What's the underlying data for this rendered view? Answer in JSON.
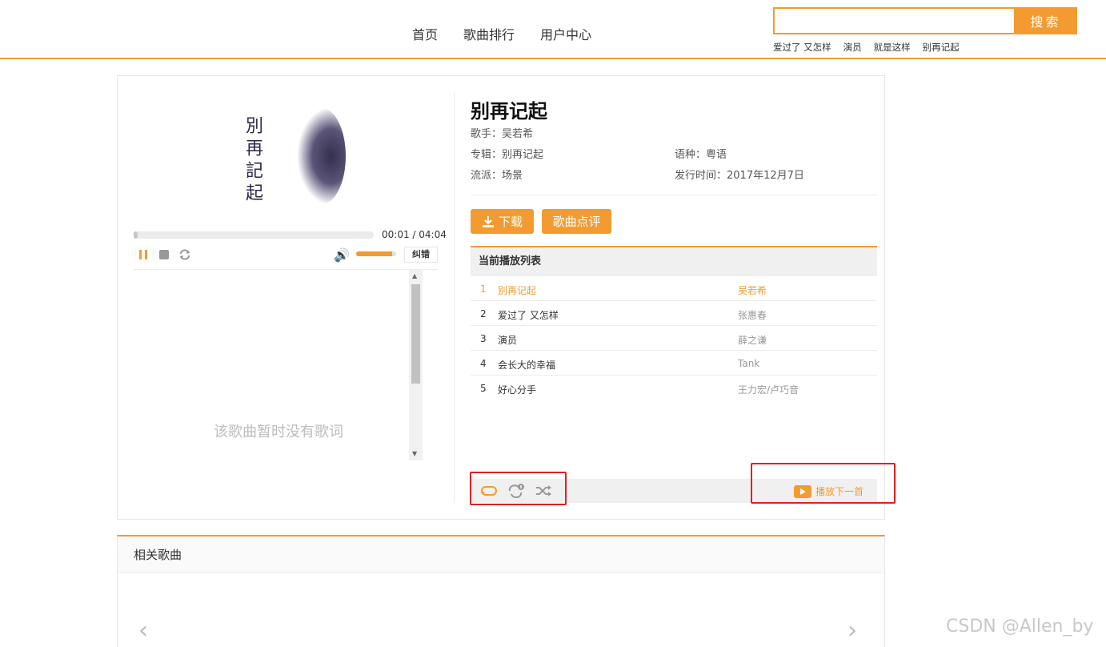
{
  "nav": {
    "items": [
      "首页",
      "歌曲排行",
      "用户中心"
    ]
  },
  "search": {
    "button": "搜索",
    "value": "",
    "hotwords": [
      "爱过了 又怎样",
      "演员",
      "就是这样",
      "别再记起"
    ]
  },
  "cover": {
    "text": "別再記起"
  },
  "player": {
    "time": "00:01 / 04:04",
    "progress": 0.004,
    "volume": 0.9,
    "correct_label": "纠错",
    "lyrics_empty": "该歌曲暂时没有歌词"
  },
  "song": {
    "title": "别再记起",
    "singer": "歌手：吴若希",
    "album": "专辑：别再记起",
    "language": "语种：粤语",
    "genre": "流派：场景",
    "release": "发行时间：2017年12月7日"
  },
  "actions": {
    "download": "下载",
    "review": "歌曲点评"
  },
  "playlist": {
    "title": "当前播放列表",
    "rows": [
      {
        "num": "1",
        "name": "别再记起",
        "artist": "吴若希"
      },
      {
        "num": "2",
        "name": "爱过了 又怎样",
        "artist": "张惠春"
      },
      {
        "num": "3",
        "name": "演员",
        "artist": "薛之谦"
      },
      {
        "num": "4",
        "name": "会长大的幸福",
        "artist": "Tank"
      },
      {
        "num": "5",
        "name": "好心分手",
        "artist": "王力宏/卢巧音"
      }
    ],
    "play_next": "播放下一首"
  },
  "related": {
    "title": "相关歌曲"
  },
  "watermark": "CSDN @Allen_by",
  "colors": {
    "accent": "#f39b30",
    "highlight": "#e02020"
  }
}
